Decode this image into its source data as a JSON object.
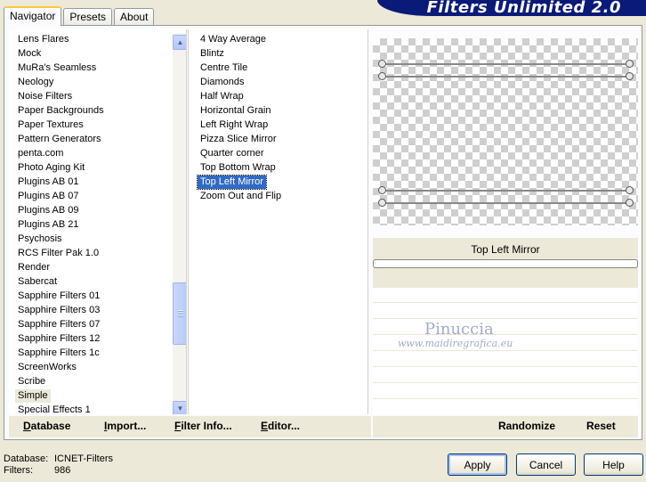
{
  "title": "Filters Unlimited 2.0",
  "tabs": [
    "Navigator",
    "Presets",
    "About"
  ],
  "categories": [
    "Lens Flares",
    "Mock",
    "MuRa's Seamless",
    "Neology",
    "Noise Filters",
    "Paper Backgrounds",
    "Paper Textures",
    "Pattern Generators",
    "penta.com",
    "Photo Aging Kit",
    "Plugins AB 01",
    "Plugins AB 07",
    "Plugins AB 09",
    "Plugins AB 21",
    "Psychosis",
    "RCS Filter Pak 1.0",
    "Render",
    "Sabercat",
    "Sapphire Filters 01",
    "Sapphire Filters 03",
    "Sapphire Filters 07",
    "Sapphire Filters 12",
    "Sapphire Filters 1c",
    "ScreenWorks",
    "Scribe",
    "Simple",
    "Special Effects 1"
  ],
  "selected_category": "Simple",
  "filters": [
    "4 Way Average",
    "Blintz",
    "Centre Tile",
    "Diamonds",
    "Half Wrap",
    "Horizontal Grain",
    "Left Right Wrap",
    "Pizza Slice Mirror",
    "Quarter corner",
    "Top Bottom Wrap",
    "Top Left Mirror",
    "Zoom Out and Flip"
  ],
  "selected_filter": "Top Left Mirror",
  "preview": {
    "filter_name": "Top Left Mirror"
  },
  "watermark": {
    "name": "Pinuccia",
    "site": "www.maidiregrafica.eu"
  },
  "panel_buttons": {
    "database": "Database",
    "import": "Import...",
    "filter_info": "Filter Info...",
    "editor": "Editor...",
    "randomize": "Randomize",
    "reset": "Reset"
  },
  "footer": {
    "database_label": "Database:",
    "database_value": "ICNET-Filters",
    "filters_label": "Filters:",
    "filters_value": "986",
    "apply": "Apply",
    "cancel": "Cancel",
    "help": "Help"
  },
  "colors": {
    "banner": "#0a1a78",
    "selection": "#316ac5",
    "tab_highlight": "#ffc83c"
  }
}
